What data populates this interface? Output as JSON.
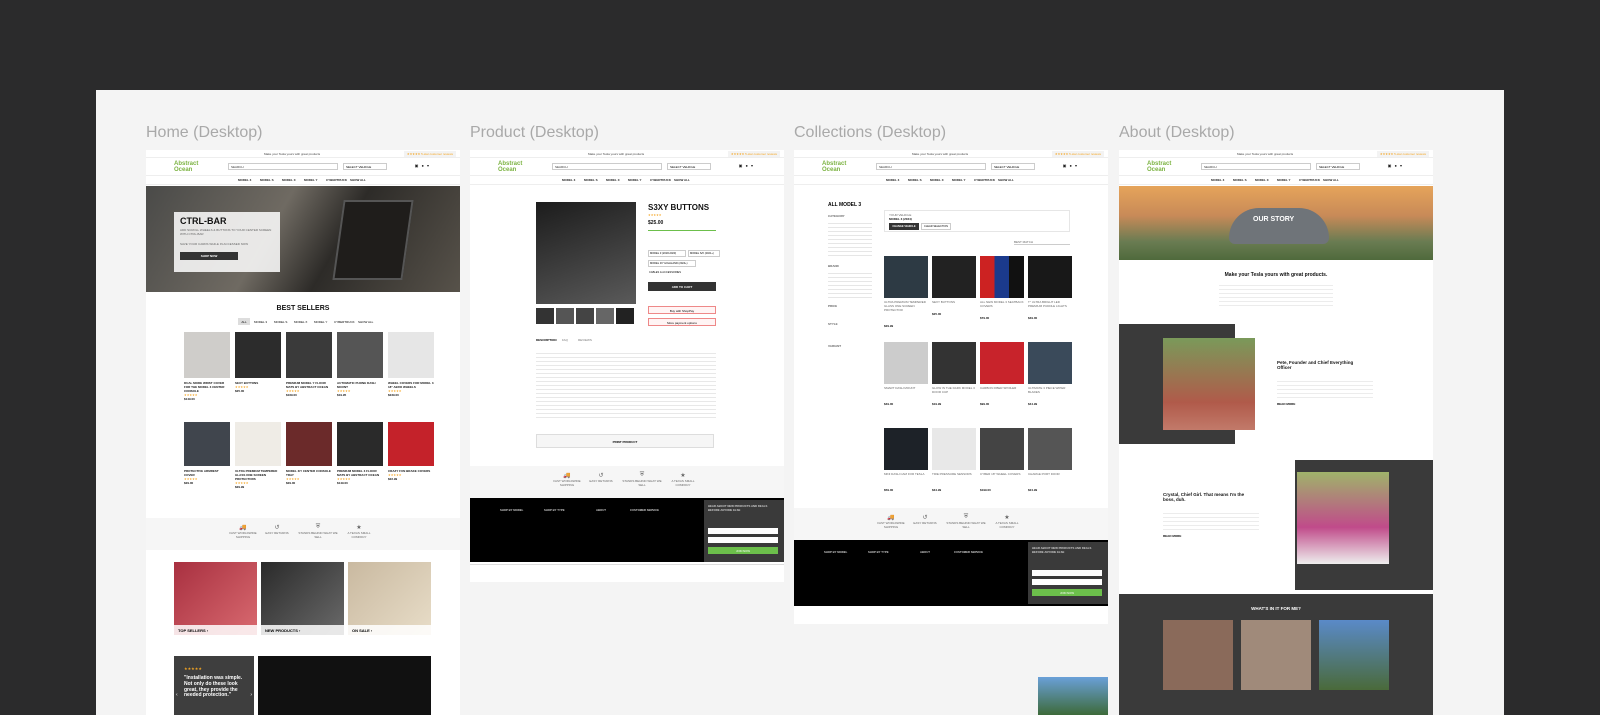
{
  "frames": {
    "home": {
      "title": "Home (Desktop)"
    },
    "product": {
      "title": "Product (Desktop)"
    },
    "collections": {
      "title": "Collections (Desktop)"
    },
    "about": {
      "title": "About (Desktop)"
    }
  },
  "site": {
    "logo_line1": "Abstract",
    "logo_line2": "Ocean",
    "top_text": "Make your Tesla yours with great products",
    "top_rating": "★★★★★ 5-star customer reviews",
    "search_placeholder": "SEARCH",
    "select_vehicle": "SELECT VEHICLE",
    "nav": [
      "MODEL 3",
      "MODEL S",
      "MODEL X",
      "MODEL Y",
      "CYBERTRUCK",
      "SHOW ALL"
    ]
  },
  "home": {
    "hero_title": "CTRL-BAR",
    "hero_sub": "ADD SCROLL WHEELS & BUTTONS TO YOUR CENTER SCREEN WITH CTRL-BAR",
    "hero_promo": "SAVE YOUR CARDS WHILE IN ACCESSED NOW",
    "hero_btn": "SHOP NOW",
    "best_sellers": "BEST SELLERS",
    "filter_tabs": [
      "ALL",
      "MODEL 3",
      "MODEL S",
      "MODEL X",
      "MODEL Y",
      "CYBERTRUCK",
      "SHOW ALL"
    ],
    "products": [
      {
        "name": "DUAL MODE WRIST COVER FOR THE MODEL 3 CENTER CONSOLE",
        "price": "$149.00"
      },
      {
        "name": "SEXY BUTTONS",
        "price": "$25.00"
      },
      {
        "name": "PREMIUM MODEL Y FLOOR MATS BY ABSTRACT OCEAN",
        "price": "$169.00"
      },
      {
        "name": "AUTOMATIC PHONE DASH MOUNT",
        "price": "$19.95"
      },
      {
        "name": "WHEEL COVERS FOR MODEL 3 18\" AERO WHEELS",
        "price": "$239.00"
      },
      {
        "name": "PROTECTIVE ARMREST COVER",
        "price": "$29.00"
      },
      {
        "name": "ULTRA PREMIUM TEMPERED GLASS ONE SCREEN PROTECTORS",
        "price": "$29.99"
      },
      {
        "name": "MODEL 3/Y CENTER CONSOLE TRAY",
        "price": "$29.00"
      },
      {
        "name": "PREMIUM MODEL 3 FLOOR MATS BY ABSTRACT OCEAN",
        "price": "$149.00"
      },
      {
        "name": "CRAZY FUN BRAKE COVERS",
        "price": "$22.99"
      }
    ],
    "badges": [
      "FAST WORLDWIDE SHIPPING",
      "EASY RETURNS",
      "STANDS BEHIND WHAT WE SELL",
      "A TEXAS SMALL COMPANY"
    ],
    "tiles": [
      "TOP SELLERS ›",
      "NEW PRODUCTS ›",
      "ON SALE ›"
    ],
    "quote": "\"Installation was simple. Not only do these look great, they provide the needed protection.\""
  },
  "product": {
    "title": "S3XY BUTTONS",
    "price": "$25.00",
    "options": [
      "MODEL 3 (2018-2023)",
      "MODEL S/X (2021+)",
      "MODEL 3/Y HIGHLAND (2024+)",
      "CABLES & ACCESSORIES"
    ],
    "add_to_cart": "ADD TO CART",
    "pay1": "Buy with ShopPay",
    "pay2": "More payment options",
    "tabs": [
      "DESCRIPTION",
      "FAQ",
      "REVIEWS"
    ],
    "print": "PRINT PRODUCT",
    "badges": [
      "FAST WORLDWIDE SHIPPING",
      "EASY RETURNS",
      "STANDS BEHIND WHAT WE SELL",
      "A TEXAS SMALL COMPANY"
    ],
    "footer_cols": [
      "SHOP BY MODEL",
      "SHOP BY TYPE",
      "ABOUT",
      "CUSTOMER SERVICE"
    ],
    "newsletter": "HEAR ABOUT NEW PRODUCTS AND DEALS BEFORE ANYONE ELSE",
    "join": "JOIN NOW"
  },
  "collections": {
    "title": "ALL MODEL 3",
    "vehicle_label": "YOUR VEHICLE",
    "vehicle": "MODEL 3 (2024)",
    "change": "CHANGE VEHICLE",
    "clear": "CLEAR SELECTION",
    "sort": "BEST MATCH",
    "filters": [
      "CATEGORY",
      "BRAND",
      "PRICE",
      "STYLE",
      "VARIANT"
    ],
    "products": [
      {
        "name": "ULTRA PREMIUM TEMPERED GLASS ONE SCREEN PROTECTOR",
        "price": "$29.99"
      },
      {
        "name": "SEXY BUTTONS",
        "price": "$25.00"
      },
      {
        "name": "ALL NEW MODEL 3 SEATBACK COVERS",
        "price": "$79.00"
      },
      {
        "name": "T\" ULTRA BRIGHT LED PREMIUM PUDDLE LIGHTS",
        "price": "$49.00"
      },
      {
        "name": "SMART DASH MOUNT",
        "price": "$49.00"
      },
      {
        "name": "GLOW IN THE DARK MODEL 3 DOOR CUP",
        "price": "$19.99"
      },
      {
        "name": "CARBON FIBER SPOILER",
        "price": "$99.00"
      },
      {
        "name": "ULTIMATE 3 PIECE WIPER BLADES",
        "price": "$44.99"
      },
      {
        "name": "MINI DASH CAM FOR TESLA",
        "price": "$59.00"
      },
      {
        "name": "TIRE PRESSURE SENSORS",
        "price": "$34.99"
      },
      {
        "name": "CYBER 18\" WHEEL COVERS",
        "price": "$199.00"
      },
      {
        "name": "CHARGE PORT DOOR",
        "price": "$24.99"
      }
    ]
  },
  "about": {
    "banner": "OUR STORY",
    "headline": "Make your Tesla yours with great products.",
    "founder_name": "Pete, Founder and Chief Everything Officer",
    "founder_link": "READ MORE",
    "crystal_name": "Crystal, Chief Girl. That means I'm the boss, duh.",
    "crystal_link": "READ MORE",
    "whats_in_it": "WHAT'S IN IT FOR ME?"
  }
}
